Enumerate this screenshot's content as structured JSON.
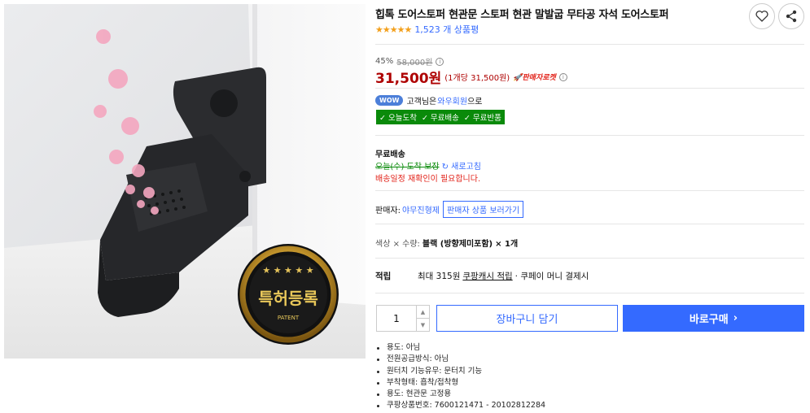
{
  "product": {
    "title": "힙톡 도어스토퍼 현관문 스토퍼 현관 말발굽 무타공 자석 도어스토퍼",
    "rating_stars": "★★★★★",
    "review_count": "1,523 개 상품평",
    "image_badge_text": "특허등록",
    "image_badge_subtext": "PATENT"
  },
  "pricing": {
    "discount": "45%",
    "original_price": "58,000원",
    "price": "31,500원",
    "unit_price": "(1개당 31,500원)",
    "rocket_label": "판매자로켓",
    "info_symbol": "i"
  },
  "membership": {
    "badge": "WOW",
    "text_before": "고객님은",
    "link": "와우회원",
    "text_after": "으로"
  },
  "benefits": [
    "✓ 오늘도착",
    "✓ 무료배송",
    "✓ 무료반품"
  ],
  "shipping": {
    "title": "무료배송",
    "struck_text": "오늘(수) 도착 보장",
    "refresh_label": "새로고침",
    "warning": "배송일정 재확인이 필요합니다."
  },
  "seller": {
    "label": "판매자:",
    "name": "야무진형제",
    "button": "판매자 상품 보러가기"
  },
  "option": {
    "label": "색상 × 수량:",
    "value": "블랙 (방향제미포함)",
    "count": "× 1개"
  },
  "points": {
    "label": "적립",
    "text_before": "최대 315원",
    "link": "쿠팡캐시 적립",
    "text_after": "· 쿠페이 머니 결제시"
  },
  "purchase": {
    "quantity": "1",
    "cart_label": "장바구니 담기",
    "buy_label": "바로구매",
    "buy_arrow": "›"
  },
  "details": [
    "용도: 아님",
    "전원공급방식: 아님",
    "원터치 기능유무: 문터치 기능",
    "부착형태: 흡착/접착형",
    "용도: 현관문 고정용",
    "쿠팡상품번호: 7600121471 - 20102812284"
  ],
  "colors": {
    "accent": "#346aff",
    "price_red": "#ae0000",
    "green_badge": "#0a8a0a",
    "star": "#f3a01c"
  }
}
